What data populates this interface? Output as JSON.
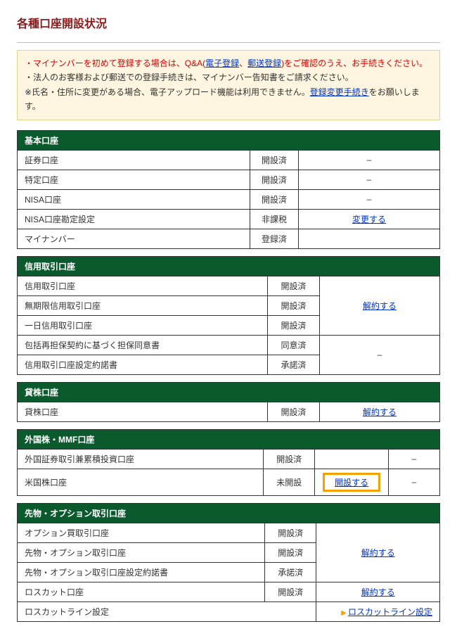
{
  "page_title": "各種口座開設状況",
  "notice": {
    "line1_a": "・マイナンバーを初めて登録する場合は、Q&A(",
    "link_e": "電子登録",
    "sep": "、",
    "link_m": "郵送登録",
    "line1_b": ")をご確認のうえ、お手続きください。",
    "line2": "・法人のお客様および郵送での登録手続きは、マイナンバー告知書をご請求ください。",
    "line3_a": "※氏名・住所に変更がある場合、電子アップロード機能は利用できません。",
    "link_c": "登録変更手続き",
    "line3_b": "をお願いします。"
  },
  "s1": {
    "header": "基本口座",
    "r1": {
      "label": "証券口座",
      "status": "開設済",
      "dash": "–"
    },
    "r2": {
      "label": "特定口座",
      "status": "開設済",
      "dash": "–"
    },
    "r3": {
      "label": "NISA口座",
      "status": "開設済",
      "dash": "–"
    },
    "r4": {
      "label": "NISA口座勘定設定",
      "status": "非課税",
      "action": "変更する"
    },
    "r5": {
      "label": "マイナンバー",
      "status": "登録済"
    }
  },
  "s2": {
    "header": "信用取引口座",
    "r1": {
      "label": "信用取引口座",
      "status": "開設済"
    },
    "r2": {
      "label": "無期限信用取引口座",
      "status": "開設済"
    },
    "r3": {
      "label": "一日信用取引口座",
      "status": "開設済"
    },
    "action": "解約する",
    "r4": {
      "label": "包括再担保契約に基づく担保同意書",
      "status": "同意済"
    },
    "r5": {
      "label": "信用取引口座設定約諾書",
      "status": "承諾済"
    },
    "dash": "–"
  },
  "s3": {
    "header": "貸株口座",
    "r1": {
      "label": "貸株口座",
      "status": "開設済",
      "action": "解約する"
    }
  },
  "s4": {
    "header": "外国株・MMF口座",
    "r1": {
      "label": "外国証券取引兼累積投資口座",
      "status": "開設済",
      "dash": "–"
    },
    "r2": {
      "label": "米国株口座",
      "status": "未開設",
      "action": "開設する",
      "dash": "–"
    }
  },
  "s5": {
    "header": "先物・オプション取引口座",
    "r1": {
      "label": "オプション買取引口座",
      "status": "開設済"
    },
    "r2": {
      "label": "先物・オプション取引口座",
      "status": "開設済"
    },
    "r3": {
      "label": "先物・オプション取引口座設定約諾書",
      "status": "承諾済"
    },
    "action1": "解約する",
    "r4": {
      "label": "ロスカット口座",
      "status": "開設済",
      "action": "解約する"
    },
    "r5": {
      "label": "ロスカットライン設定",
      "action": "ロスカットライン設定"
    }
  }
}
